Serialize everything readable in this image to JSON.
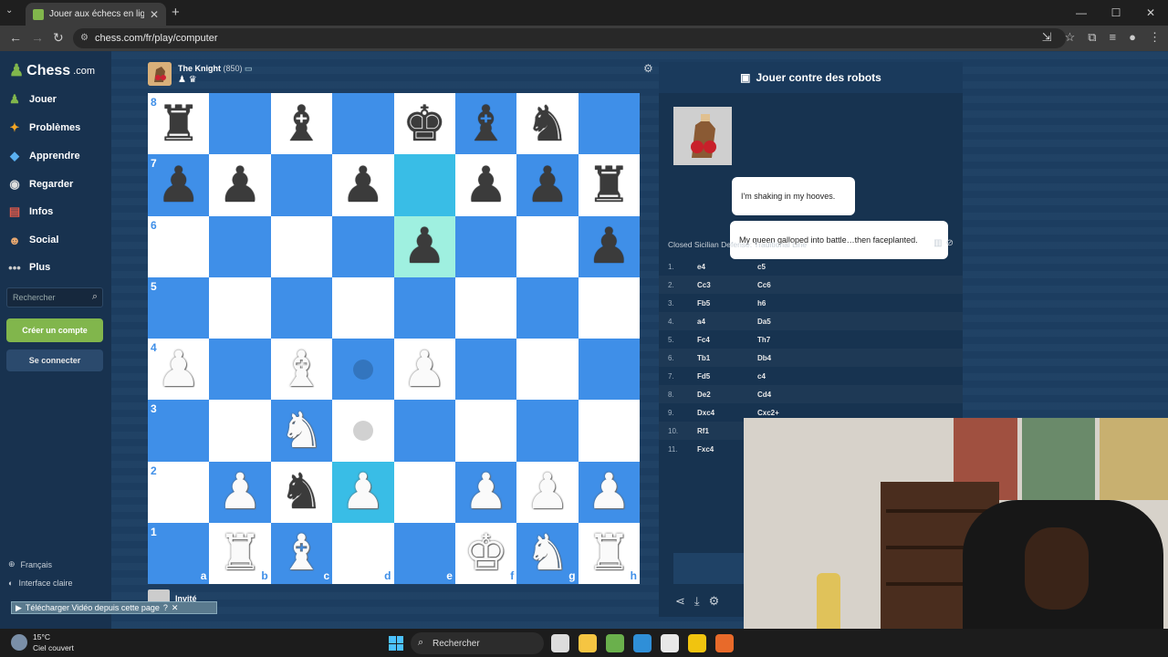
{
  "browser": {
    "tab_title": "Jouer aux échecs en ligne contre",
    "tab_close": "✕",
    "new_tab": "+",
    "url": "chess.com/fr/play/computer",
    "controls": [
      "—",
      "☐",
      "✕"
    ]
  },
  "sidebar": {
    "logo_text": "Chess",
    "logo_suffix": ".com",
    "items": [
      {
        "label": "Jouer",
        "icon": "play-icon"
      },
      {
        "label": "Problèmes",
        "icon": "puzzle-icon"
      },
      {
        "label": "Apprendre",
        "icon": "learn-icon"
      },
      {
        "label": "Regarder",
        "icon": "binoculars-icon"
      },
      {
        "label": "Infos",
        "icon": "news-icon"
      },
      {
        "label": "Social",
        "icon": "social-icon"
      },
      {
        "label": "Plus",
        "icon": "more-icon"
      }
    ],
    "search_placeholder": "Rechercher",
    "create_account": "Créer un compte",
    "login": "Se connecter",
    "language": "Français",
    "theme": "Interface claire"
  },
  "game": {
    "opponent_name": "The Knight",
    "opponent_rating": "(850)",
    "bottom_player": "Invité",
    "ranks": [
      "8",
      "7",
      "6",
      "5",
      "4",
      "3",
      "2",
      "1"
    ],
    "files": [
      "a",
      "b",
      "c",
      "d",
      "e",
      "f",
      "g",
      "h"
    ],
    "board": [
      [
        "r",
        "",
        "b",
        "",
        "k",
        "b",
        "n",
        ""
      ],
      [
        "p",
        "p",
        "",
        "p",
        "",
        "p",
        "p",
        "r"
      ],
      [
        "",
        "",
        "",
        "",
        "p",
        "",
        "",
        "p"
      ],
      [
        "",
        "",
        "",
        "",
        "",
        "",
        "",
        ""
      ],
      [
        "P",
        "",
        "B",
        "",
        "P",
        "",
        "",
        ""
      ],
      [
        "",
        "",
        "N",
        "",
        "",
        "",
        "",
        ""
      ],
      [
        "",
        "P",
        "n",
        "P",
        "",
        "P",
        "P",
        "P"
      ],
      [
        "",
        "R",
        "B",
        "",
        "",
        "K",
        "N",
        "R"
      ]
    ],
    "highlight_squares": [
      "e7",
      "e6",
      "d2"
    ],
    "move_hints": [
      "d4",
      "d3"
    ]
  },
  "panel": {
    "title": "Jouer contre des robots",
    "bot_messages": [
      "I'm shaking in my hooves.",
      "My queen galloped into battle…then faceplanted."
    ],
    "opening": "Closed Sicilian Defense: Traditional Line",
    "moves": [
      {
        "num": "1.",
        "white": "e4",
        "black": "c5"
      },
      {
        "num": "2.",
        "white": "Cc3",
        "black": "Cc6"
      },
      {
        "num": "3.",
        "white": "Fb5",
        "black": "h6"
      },
      {
        "num": "4.",
        "white": "a4",
        "black": "Da5"
      },
      {
        "num": "5.",
        "white": "Fc4",
        "black": "Th7"
      },
      {
        "num": "6.",
        "white": "Tb1",
        "black": "Db4"
      },
      {
        "num": "7.",
        "white": "Fd5",
        "black": "c4"
      },
      {
        "num": "8.",
        "white": "De2",
        "black": "Cd4"
      },
      {
        "num": "9.",
        "white": "Dxc4",
        "black": "Cxc2+"
      },
      {
        "num": "10.",
        "white": "Rf1",
        "black": ""
      },
      {
        "num": "11.",
        "white": "Fxc4",
        "black": ""
      }
    ]
  },
  "download_bar": "Télécharger Vidéo depuis cette page",
  "taskbar": {
    "temp": "15°C",
    "weather": "Ciel couvert",
    "search": "Rechercher"
  },
  "colors": {
    "board_light": "#ffffff",
    "board_dark": "#3f8fe8",
    "accent_green": "#81b64c",
    "page_bg": "#1d3f63"
  }
}
